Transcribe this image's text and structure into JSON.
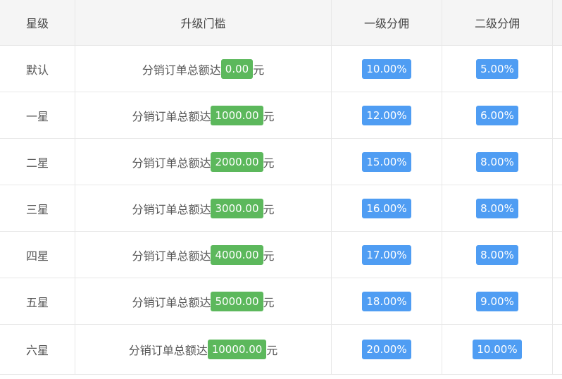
{
  "headers": {
    "level": "星级",
    "threshold": "升级门槛",
    "first": "一级分佣",
    "second": "二级分佣"
  },
  "threshold_prefix": "分销订单总额达",
  "threshold_unit": "元",
  "colors": {
    "threshold_badge": "#5cb85c",
    "rate_badge": "#4f9df3",
    "header_bg": "#f5f5f5"
  },
  "rows": [
    {
      "level": "默认",
      "amount": "0.00",
      "first": "10.00%",
      "second": "5.00%"
    },
    {
      "level": "一星",
      "amount": "1000.00",
      "first": "12.00%",
      "second": "6.00%"
    },
    {
      "level": "二星",
      "amount": "2000.00",
      "first": "15.00%",
      "second": "8.00%"
    },
    {
      "level": "三星",
      "amount": "3000.00",
      "first": "16.00%",
      "second": "8.00%"
    },
    {
      "level": "四星",
      "amount": "4000.00",
      "first": "17.00%",
      "second": "8.00%"
    },
    {
      "level": "五星",
      "amount": "5000.00",
      "first": "18.00%",
      "second": "9.00%"
    },
    {
      "level": "六星",
      "amount": "10000.00",
      "first": "20.00%",
      "second": "10.00%"
    }
  ]
}
